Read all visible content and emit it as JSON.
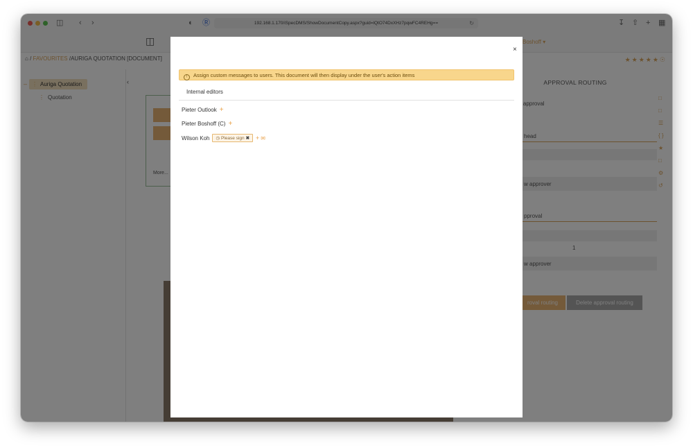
{
  "browser": {
    "url": "192.168.1.170/iSpecDMS/ShowDocumentCopy.aspx?guid=lQtO74DxXHz7pqwFC4REHg==",
    "reload_icon": "reload-icon"
  },
  "app": {
    "user_menu": "Boshoff ▾"
  },
  "breadcrumb": {
    "home_sep": "/",
    "favourites": "FAVOURITES",
    "current": "/AURIGA QUOTATION [DOCUMENT]"
  },
  "sidebar": {
    "root": "Auriga Quotation",
    "child": "Quotation",
    "collapse": "‹"
  },
  "approval": {
    "title": "APPROVAL ROUTING",
    "rows": [
      "r approval",
      "head",
      "w approver",
      "pproval",
      "w approver"
    ],
    "counter": "1",
    "button_primary": "roval routing",
    "button_delete": "Delete approval routing"
  },
  "doc": {
    "more": "More..."
  },
  "modal": {
    "close": "×",
    "alert": "Assign custom messages to users. This document will then display under the user's action items",
    "tab": "Internal editors",
    "users": [
      {
        "name": "Pieter Outlook"
      },
      {
        "name": "Pieter Boshoff (C)"
      },
      {
        "name": "Wilson Koh",
        "tag": "Please sign"
      }
    ]
  }
}
